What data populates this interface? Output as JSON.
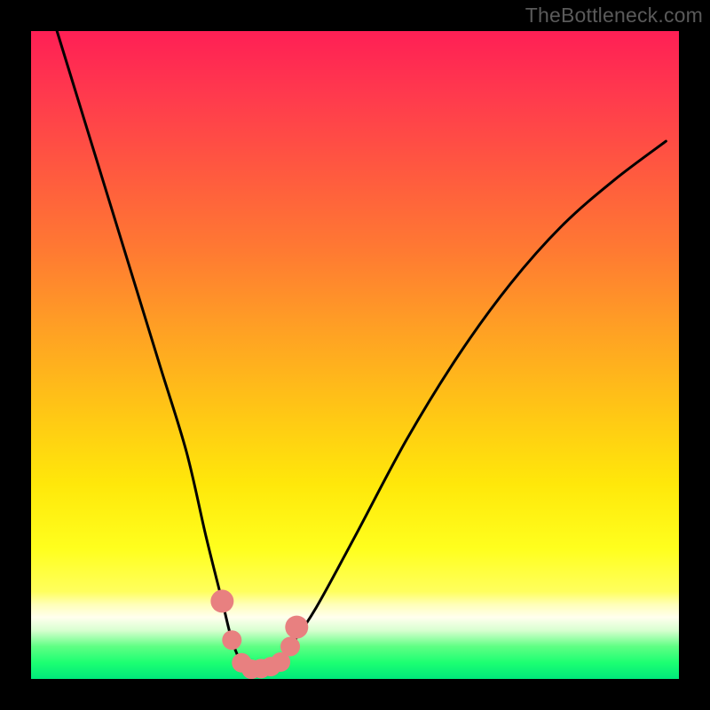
{
  "watermark": "TheBottleneck.com",
  "chart_data": {
    "type": "line",
    "title": "",
    "xlabel": "",
    "ylabel": "",
    "xlim": [
      0,
      100
    ],
    "ylim": [
      0,
      100
    ],
    "series": [
      {
        "name": "bottleneck-curve",
        "x": [
          4,
          8,
          12,
          16,
          20,
          24,
          27,
          29.5,
          31,
          32.5,
          34,
          36,
          38,
          40,
          44,
          50,
          58,
          66,
          74,
          82,
          90,
          98
        ],
        "values": [
          100,
          87,
          74,
          61,
          48,
          35,
          22,
          12,
          6,
          2.5,
          1.5,
          1.7,
          2.8,
          5,
          11,
          22,
          37,
          50,
          61,
          70,
          77,
          83
        ]
      }
    ],
    "markers": {
      "name": "highlight-dots",
      "color": "#e88080",
      "points_x": [
        29.5,
        31,
        32.5,
        34,
        35.5,
        37,
        38.5,
        40,
        41
      ],
      "points_values": [
        12,
        6,
        2.5,
        1.5,
        1.6,
        1.9,
        2.6,
        5,
        8
      ],
      "radius_main": 11,
      "radius_ends": 13
    }
  }
}
